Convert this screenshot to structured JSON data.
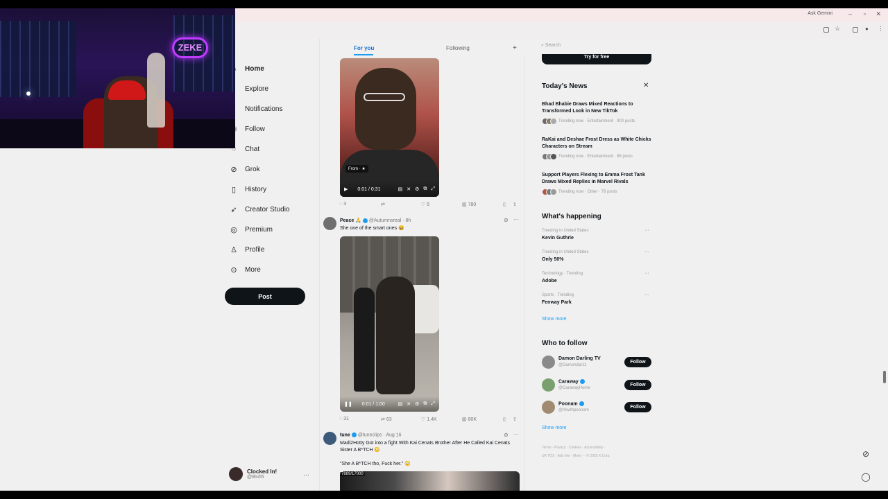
{
  "browser": {
    "gemini_label": "Ask Gemini",
    "search_placeholder": "Search"
  },
  "webcam": {
    "neon_sign": "ZEKE"
  },
  "nav": {
    "items": [
      {
        "label": "Home",
        "icon": "home-icon",
        "glyph": "⌂"
      },
      {
        "label": "Explore",
        "icon": "search-icon",
        "glyph": "⌕"
      },
      {
        "label": "Notifications",
        "icon": "bell-icon",
        "glyph": "♪"
      },
      {
        "label": "Follow",
        "icon": "follow-icon",
        "glyph": "⚇"
      },
      {
        "label": "Chat",
        "icon": "chat-icon",
        "glyph": "◌"
      },
      {
        "label": "Grok",
        "icon": "grok-icon",
        "glyph": "⊘"
      },
      {
        "label": "History",
        "icon": "bookmark-icon",
        "glyph": "▯"
      },
      {
        "label": "Creator Studio",
        "icon": "rocket-icon",
        "glyph": "➶"
      },
      {
        "label": "Premium",
        "icon": "premium-icon",
        "glyph": "◎"
      },
      {
        "label": "Profile",
        "icon": "profile-icon",
        "glyph": "♙"
      },
      {
        "label": "More",
        "icon": "more-icon",
        "glyph": "⊙"
      }
    ],
    "post_button": "Post",
    "account": {
      "name": "Clocked In!",
      "handle": "@9tuh5"
    }
  },
  "feed": {
    "tabs": [
      "For you",
      "Following"
    ],
    "post1": {
      "from_badge": "From · ★",
      "video_time": "0:01 / 0:31",
      "actions": {
        "replies": "3",
        "reposts": "",
        "likes": "5",
        "views": "780"
      }
    },
    "post2": {
      "name": "Peace 🙏",
      "handle": "@Autumnsreal",
      "time": "8h",
      "text": "She one of the smart ones 😆",
      "video_time": "0:01 / 1:00",
      "actions": {
        "replies": "31",
        "reposts": "63",
        "likes": "1.4K",
        "views": "80K"
      }
    },
    "post3": {
      "name": "tune",
      "handle": "@tuneclips",
      "time": "Aug 16",
      "text1": "Madi2Hotty Got into a fight With Kai Cenats Brother After He Called Kai Cenats Sister A B*TCH 😳",
      "text2": "\"She A B*TCH tho, Fuck her.\" 😳",
      "video_label": "7889/17000"
    }
  },
  "sidebar": {
    "promo_button": "Try for free",
    "news": {
      "title": "Today's News",
      "items": [
        {
          "title": "Bhad Bhabie Draws Mixed Reactions to Transformed Look in New TikTok",
          "meta": "Trending now · Entertainment · 900 posts"
        },
        {
          "title": "RaKai and Deshae Frost Dress as White Chicks Characters on Stream",
          "meta": "Trending now · Entertainment · 88 posts"
        },
        {
          "title": "Support Players Flexing to Emma Frost Tank Draws Mixed Replies in Marvel Rivals",
          "meta": "Trending now · Other · 79 posts"
        }
      ]
    },
    "happening": {
      "title": "What's happening",
      "trends": [
        {
          "context": "Trending in United States",
          "name": "Kevin Guthrie"
        },
        {
          "context": "Trending in United States",
          "name": "Only 50%"
        },
        {
          "context": "Technology · Trending",
          "name": "Adobe"
        },
        {
          "context": "Sports · Trending",
          "name": "Fenway Park"
        }
      ],
      "show_more": "Show more"
    },
    "who_to_follow": {
      "title": "Who to follow",
      "users": [
        {
          "name": "Damon Darling TV",
          "handle": "@Damondar11",
          "button": "Follow",
          "verified": false
        },
        {
          "name": "Caraway",
          "handle": "@CarawayHome",
          "button": "Follow",
          "verified": true
        },
        {
          "name": "Poonam",
          "handle": "@Alwithpoonam",
          "button": "Follow",
          "verified": true
        }
      ],
      "show_more": "Show more"
    },
    "footer": {
      "line1": "Terms · Privacy · Cookies · Accessibility ·",
      "line2": "UK TOS · Ads info · More ··· © 2025 X Corp."
    }
  }
}
